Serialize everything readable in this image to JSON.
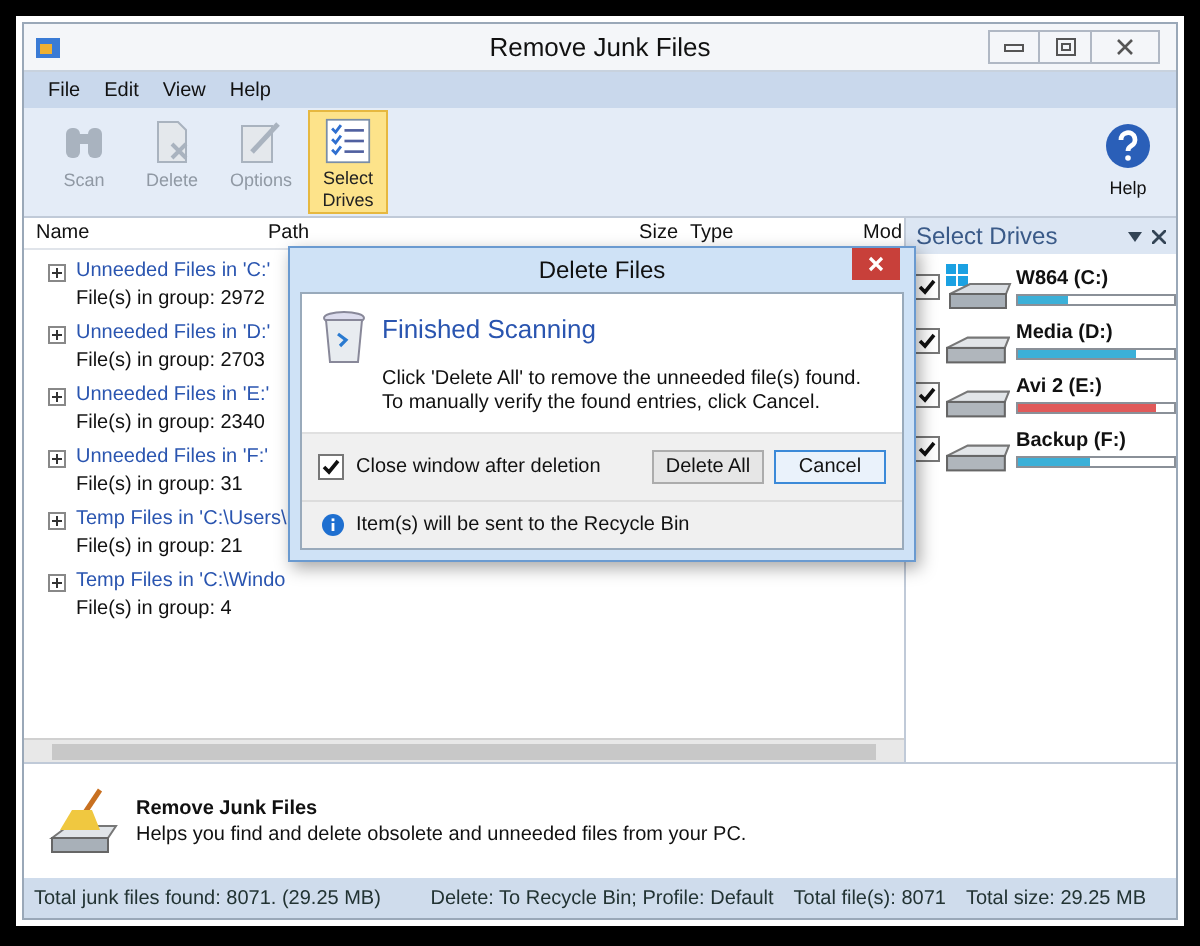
{
  "window": {
    "title": "Remove Junk Files"
  },
  "menu": [
    {
      "label": "File"
    },
    {
      "label": "Edit"
    },
    {
      "label": "View"
    },
    {
      "label": "Help"
    }
  ],
  "toolbar": [
    {
      "label": "Scan",
      "kind": "binoculars",
      "disabled": true,
      "selected": false
    },
    {
      "label": "Delete",
      "kind": "delete",
      "disabled": true,
      "selected": false
    },
    {
      "label": "Options",
      "kind": "options",
      "disabled": true,
      "selected": false
    },
    {
      "label": "Select Drives",
      "kind": "checklist",
      "disabled": false,
      "selected": true
    }
  ],
  "help_button": {
    "label": "Help"
  },
  "table": {
    "columns": [
      "Name",
      "Path",
      "Size",
      "Type",
      "Mod"
    ],
    "groups": [
      {
        "title": "Unneeded Files in 'C:'",
        "count": "File(s) in group: 2972",
        "expanded": false
      },
      {
        "title": "Unneeded Files in 'D:'",
        "count": "File(s) in group: 2703",
        "expanded": false
      },
      {
        "title": "Unneeded Files in 'E:'",
        "count": "File(s) in group: 2340",
        "expanded": false
      },
      {
        "title": "Unneeded Files in 'F:'",
        "count": "File(s) in group: 31",
        "expanded": false
      },
      {
        "title": "Temp Files in 'C:\\Users\\",
        "count": "File(s) in group: 21",
        "expanded": false
      },
      {
        "title": "Temp Files in 'C:\\Windo",
        "count": "File(s) in group: 4",
        "expanded": false
      }
    ]
  },
  "drives_pane": {
    "title": "Select Drives",
    "drives": [
      {
        "name": "W864 (C:)",
        "kind": "windows",
        "checked": true,
        "level": 0.32,
        "color": "#3bb0d8"
      },
      {
        "name": "Media (D:)",
        "kind": "disk",
        "checked": true,
        "level": 0.76,
        "color": "#3bb0d8"
      },
      {
        "name": "Avi 2 (E:)",
        "kind": "disk",
        "checked": true,
        "level": 0.88,
        "color": "#e05a5a"
      },
      {
        "name": "Backup (F:)",
        "kind": "disk",
        "checked": true,
        "level": 0.46,
        "color": "#3bb0d8"
      }
    ]
  },
  "info_panel": {
    "title": "Remove Junk Files",
    "description": "Helps you find and delete obsolete and unneeded files from your PC."
  },
  "status_bar": {
    "left": "Total junk files found: 8071. (29.25 MB)",
    "fields": [
      "Delete: To Recycle Bin; Profile: Default",
      "Total file(s): 8071",
      "Total size: 29.25 MB"
    ]
  },
  "dialog": {
    "title": "Delete Files",
    "heading": "Finished Scanning",
    "lines": [
      "Click 'Delete All' to remove the unneeded file(s) found.",
      "To manually verify the found entries, click Cancel."
    ],
    "checkbox": {
      "label": "Close window after deletion",
      "checked": true
    },
    "buttons": [
      {
        "label": "Delete All",
        "default": false
      },
      {
        "label": "Cancel",
        "default": true
      }
    ],
    "footer": "Item(s) will be sent to the Recycle Bin"
  }
}
